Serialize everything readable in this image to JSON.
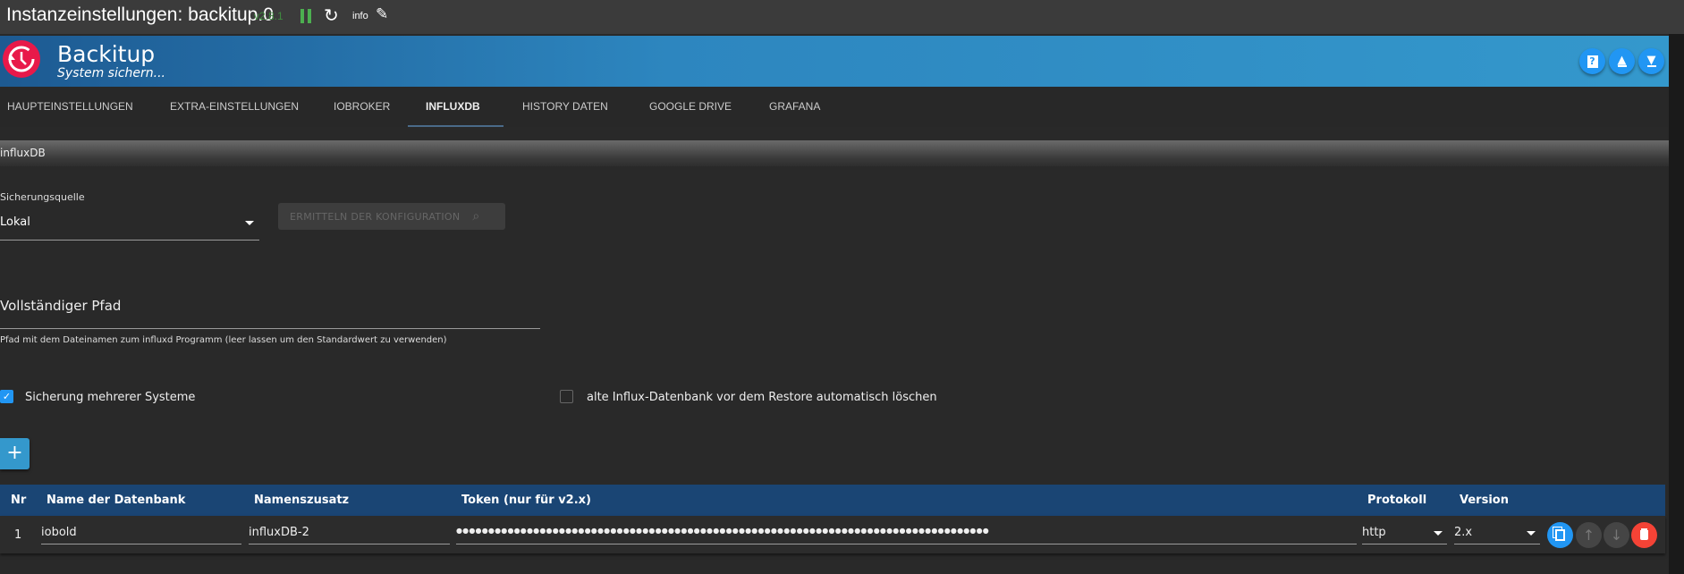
{
  "titlebar": {
    "title": "Instanzeinstellungen: backitup.0",
    "version": "v2.8.1",
    "info": "info"
  },
  "banner": {
    "name": "Backitup",
    "subtitle": "System sichern..."
  },
  "tabs": [
    {
      "label": "HAUPTEINSTELLUNGEN"
    },
    {
      "label": "EXTRA-EINSTELLUNGEN"
    },
    {
      "label": "IOBROKER"
    },
    {
      "label": "INFLUXDB",
      "active": true
    },
    {
      "label": "HISTORY DATEN"
    },
    {
      "label": "GOOGLE DRIVE"
    },
    {
      "label": "GRAFANA"
    }
  ],
  "section": {
    "title": "influxDB"
  },
  "source": {
    "label": "Sicherungsquelle",
    "value": "Lokal"
  },
  "detect_button": "ERMITTELN DER KONFIGURATION",
  "path": {
    "label": "Vollständiger Pfad",
    "value": "",
    "helper": "Pfad mit dem Dateinamen zum influxd Programm (leer lassen um den Standardwert zu verwenden)"
  },
  "checkboxes": {
    "multi": {
      "label": "Sicherung mehrerer Systeme",
      "checked": true
    },
    "delete_old": {
      "label": "alte Influx-Datenbank vor dem Restore automatisch löschen",
      "checked": false
    }
  },
  "add_button": "+",
  "table": {
    "headers": [
      "Nr",
      "Name der Datenbank",
      "Namenszusatz",
      "Token (nur für v2.x)",
      "Protokoll",
      "Version"
    ],
    "rows": [
      {
        "nr": "1",
        "name": "iobold",
        "suffix": "influxDB-2",
        "token": "●●●●●●●●●●●●●●●●●●●●●●●●●●●●●●●●●●●●●●●●●●●●●●●●●●●●●●●●●●●●●●●●●●●●●●●●●●●●●●●●●●●",
        "protocol": "http",
        "version": "2.x"
      }
    ]
  },
  "colors": {
    "accent": "#2196f3",
    "header": "#1a4574",
    "danger": "#f44336",
    "logo": "#e8194a"
  }
}
